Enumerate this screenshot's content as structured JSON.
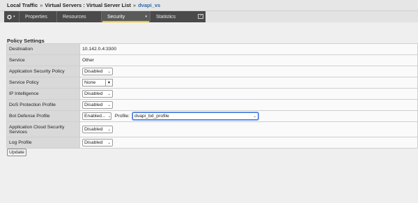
{
  "breadcrumb": {
    "items": [
      "Local Traffic",
      "Virtual Servers : Virtual Server List",
      "dvapi_vs"
    ],
    "separator": "»"
  },
  "tabs": {
    "gear": {
      "icon": "gear-icon",
      "caret": "▾"
    },
    "properties": "Properties",
    "resources": "Resources",
    "security": "Security",
    "security_caret": "▾",
    "statistics": "Statistics",
    "statistics_icon": "popout-icon",
    "active": "Security",
    "active_accent": "#f3c600"
  },
  "policy": {
    "title": "Policy Settings",
    "rows": {
      "destination": {
        "label": "Destination",
        "value": "10.142.0.4:3300"
      },
      "service": {
        "label": "Service",
        "value": "Other"
      },
      "app_security": {
        "label": "Application Security Policy",
        "value": "Disabled"
      },
      "service_policy": {
        "label": "Service Policy",
        "value": "None"
      },
      "ip_intel": {
        "label": "IP Intelligence",
        "value": "Disabled"
      },
      "dos": {
        "label": "DoS Protection Profile",
        "value": "Disabled"
      },
      "bot": {
        "label": "Bot Defense Profile",
        "value": "Enabled...",
        "profile_label": "Profile:",
        "profile_value": "dvapi_bd_profile"
      },
      "app_cloud": {
        "label": "Application Cloud Security Services",
        "value": "Disabled"
      },
      "log": {
        "label": "Log Profile",
        "value": "Disabled"
      }
    }
  },
  "actions": {
    "update": "Update"
  }
}
